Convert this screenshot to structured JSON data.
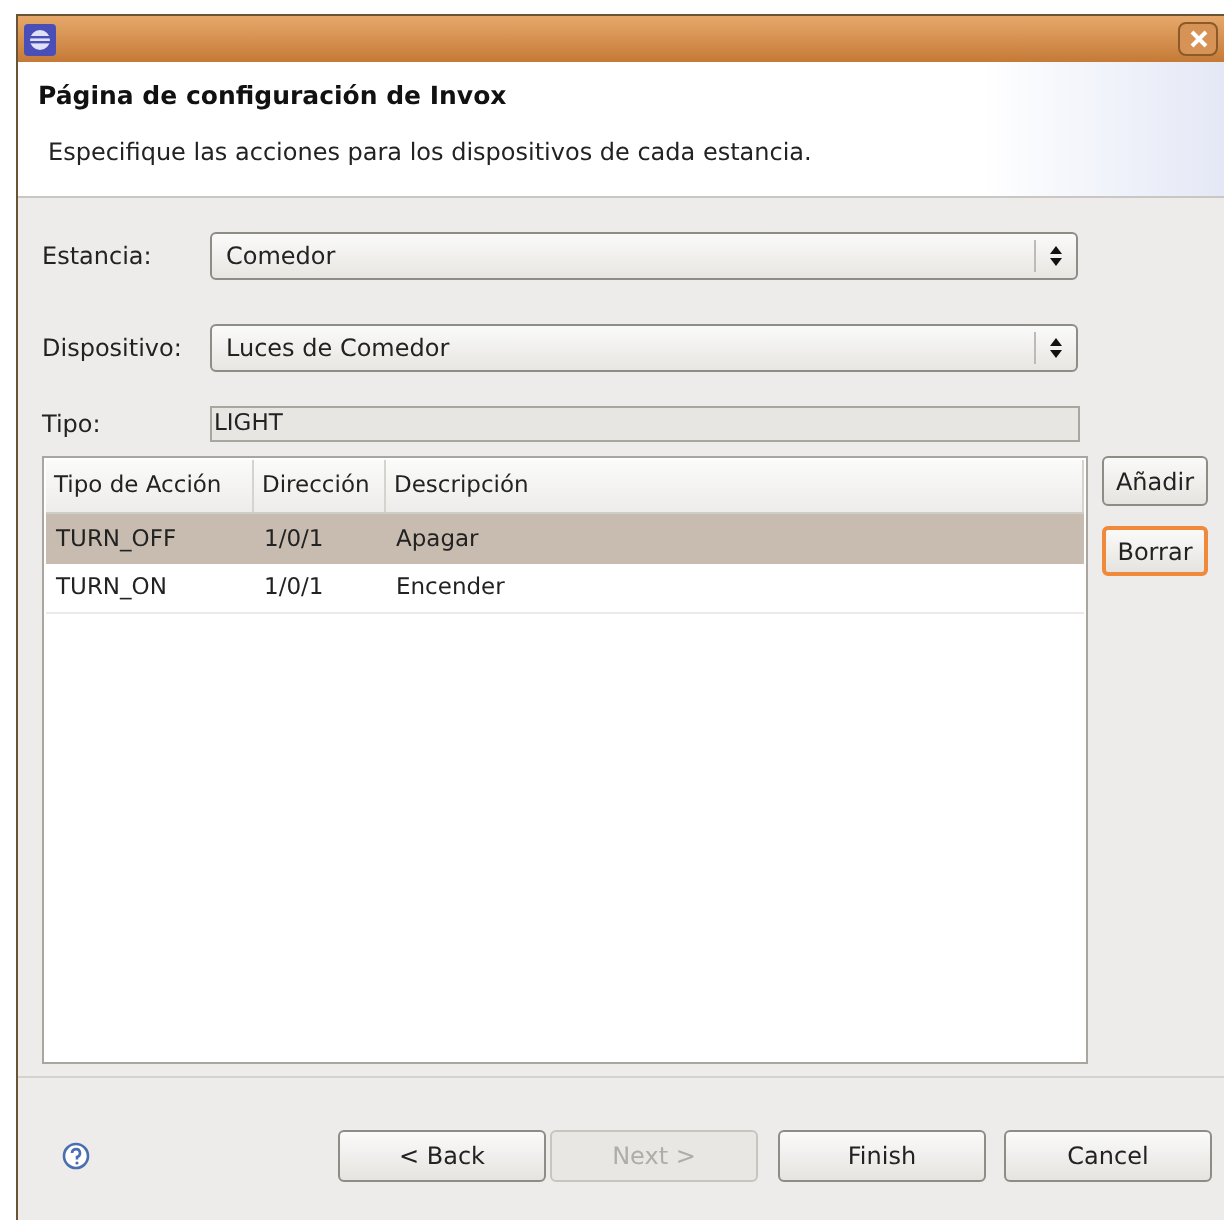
{
  "header": {
    "title": "Página de configuración de Invox",
    "description": "Especifique las acciones para los dispositivos de cada estancia."
  },
  "fields": [
    {
      "kind": "combo",
      "label": "Estancia:",
      "value": "Comedor"
    },
    {
      "kind": "combo",
      "label": "Dispositivo:",
      "value": "Luces de Comedor"
    },
    {
      "kind": "readonly",
      "label": "Tipo:",
      "value": "LIGHT"
    }
  ],
  "table": {
    "columns": [
      "Tipo de Acción",
      "Dirección",
      "Descripción"
    ],
    "rows": [
      {
        "cells": [
          "TURN_OFF",
          "1/0/1",
          "Apagar"
        ],
        "selected": true
      },
      {
        "cells": [
          "TURN_ON",
          "1/0/1",
          "Encender"
        ],
        "selected": false
      }
    ]
  },
  "side_buttons": [
    {
      "label": "Añadir",
      "focused": false
    },
    {
      "label": "Borrar",
      "focused": true
    }
  ],
  "buttons": [
    {
      "label": "< Back",
      "disabled": false
    },
    {
      "label": "Next >",
      "disabled": true
    },
    {
      "label": "Finish",
      "disabled": false
    },
    {
      "label": "Cancel",
      "disabled": false
    }
  ]
}
